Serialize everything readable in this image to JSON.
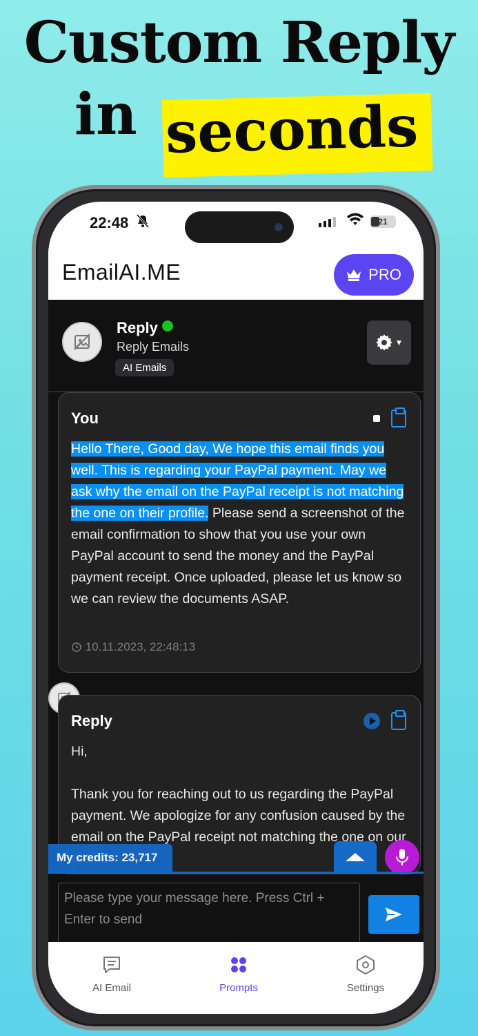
{
  "promo": {
    "line1": "Custom Reply",
    "line2_word1": "in",
    "line2_word2": "seconds"
  },
  "status_bar": {
    "time": "22:48",
    "battery": "21"
  },
  "app": {
    "title": "EmailAI.ME",
    "pro_label": "PRO"
  },
  "chat": {
    "name": "Reply",
    "subtitle": "Reply Emails",
    "tag": "AI Emails"
  },
  "messages": [
    {
      "author": "You",
      "highlighted_text": "Hello There,  Good day, We hope this email finds you well.  This is regarding your PayPal payment. May we ask why the email on the PayPal receipt is not matching the one on their profile.",
      "text": "   Please send a screenshot of the email confirmation to show that you use your own PayPal account to send the money and the PayPal payment receipt.  Once uploaded, please let us know so we can review the documents ASAP.",
      "timestamp": "10.11.2023, 22:48:13"
    },
    {
      "author": "Reply",
      "greeting": "Hi,",
      "text": "Thank you for reaching out to us regarding the PayPal payment. We apologize for any confusion caused by the email on the PayPal receipt not matching the one on our profile."
    }
  ],
  "credits": "My credits: 23,717",
  "composer": {
    "placeholder": "Please type your message here. Press Ctrl + Enter to send"
  },
  "tabs": [
    {
      "label": "AI Email",
      "icon": "chat-icon",
      "active": false
    },
    {
      "label": "Prompts",
      "icon": "grid-dots-icon",
      "active": true
    },
    {
      "label": "Settings",
      "icon": "hexagon-settings-icon",
      "active": false
    }
  ],
  "colors": {
    "accent": "#5b44f2",
    "highlight": "#0a90f2",
    "send": "#1182e4",
    "mic": "#b81bd6",
    "online": "#16c21c",
    "promo_highlight": "#fff200"
  }
}
